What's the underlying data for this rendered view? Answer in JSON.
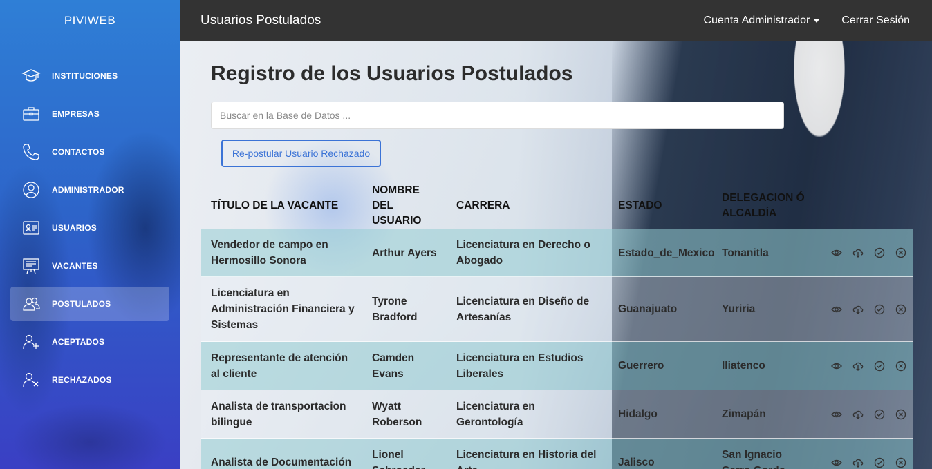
{
  "sidebar": {
    "brand": "PIVIWEB",
    "items": [
      {
        "label": "INSTITUCIONES",
        "icon": "graduation-cap-icon"
      },
      {
        "label": "EMPRESAS",
        "icon": "briefcase-icon"
      },
      {
        "label": "CONTACTOS",
        "icon": "phone-icon"
      },
      {
        "label": "ADMINISTRADOR",
        "icon": "user-circle-icon"
      },
      {
        "label": "USUARIOS",
        "icon": "id-card-icon"
      },
      {
        "label": "VACANTES",
        "icon": "presentation-board-icon"
      },
      {
        "label": "POSTULADOS",
        "icon": "users-icon",
        "active": true
      },
      {
        "label": "ACEPTADOS",
        "icon": "user-plus-icon"
      },
      {
        "label": "RECHAZADOS",
        "icon": "user-x-icon"
      }
    ]
  },
  "topbar": {
    "title": "Usuarios Postulados",
    "account": "Cuenta Administrador",
    "logout": "Cerrar Sesión"
  },
  "main": {
    "heading": "Registro de los Usuarios Postulados",
    "search_placeholder": "Buscar en la Base de Datos ...",
    "repost_button": "Re-postular Usuario Rechazado"
  },
  "table": {
    "headers": [
      "TÍTULO DE LA VACANTE",
      "NOMBRE DEL USUARIO",
      "CARRERA",
      "ESTADO",
      "DELEGACION Ó ALCALDÍA"
    ],
    "rows": [
      [
        "Vendedor de campo en Hermosillo Sonora",
        "Arthur Ayers",
        "Licenciatura en Derecho o Abogado",
        "Estado_de_Mexico",
        "Tonanitla"
      ],
      [
        "Licenciatura en Administración Financiera y Sistemas",
        "Tyrone Bradford",
        "Licenciatura en Diseño de Artesanías",
        "Guanajuato",
        "Yuriria"
      ],
      [
        "Representante de atención al cliente",
        "Camden Evans",
        "Licenciatura en Estudios Liberales",
        "Guerrero",
        "Iliatenco"
      ],
      [
        "Analista de transportacion bilingue",
        "Wyatt Roberson",
        "Licenciatura en Gerontología",
        "Hidalgo",
        "Zimapán"
      ],
      [
        "Analista de Documentación",
        "Lionel Schroeder",
        "Licenciatura en Historia del Arte",
        "Jalisco",
        "San Ignacio Cerro Gordo"
      ]
    ],
    "row_actions": [
      "eye-icon",
      "cloud-download-icon",
      "check-circle-icon",
      "x-circle-icon"
    ]
  }
}
